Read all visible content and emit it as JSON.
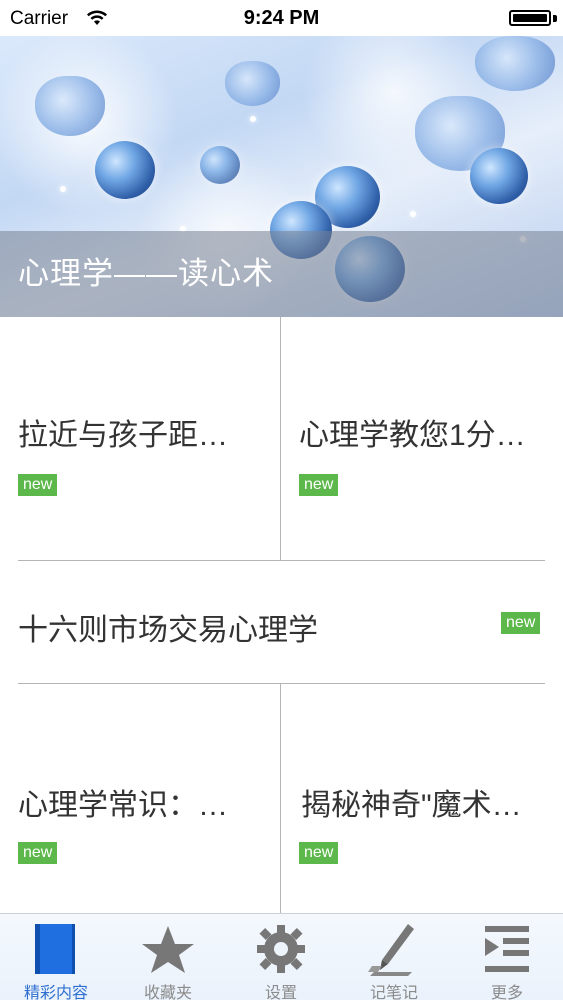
{
  "status_bar": {
    "carrier": "Carrier",
    "time": "9:24 PM"
  },
  "banner": {
    "caption": "心理学——读心术"
  },
  "articles": [
    {
      "title": "拉近与孩子距…",
      "badge": "new"
    },
    {
      "title": "心理学教您1分…",
      "badge": "new"
    },
    {
      "title": "十六则市场交易心理学",
      "badge": "new"
    },
    {
      "title": "心理学常识：…",
      "badge": "new"
    },
    {
      "title": "揭秘神奇\"魔术…",
      "badge": "new"
    }
  ],
  "tab_bar": {
    "items": [
      {
        "label": "精彩内容",
        "icon": "book-icon",
        "active": true
      },
      {
        "label": "收藏夹",
        "icon": "star-icon",
        "active": false
      },
      {
        "label": "设置",
        "icon": "gear-icon",
        "active": false
      },
      {
        "label": "记笔记",
        "icon": "pen-icon",
        "active": false
      },
      {
        "label": "更多",
        "icon": "list-indent-icon",
        "active": false
      }
    ]
  },
  "colors": {
    "badge_green": "#5cb84a",
    "active_tab_blue": "#2f6fd0",
    "inactive_tab_gray": "#8b8b8b"
  }
}
